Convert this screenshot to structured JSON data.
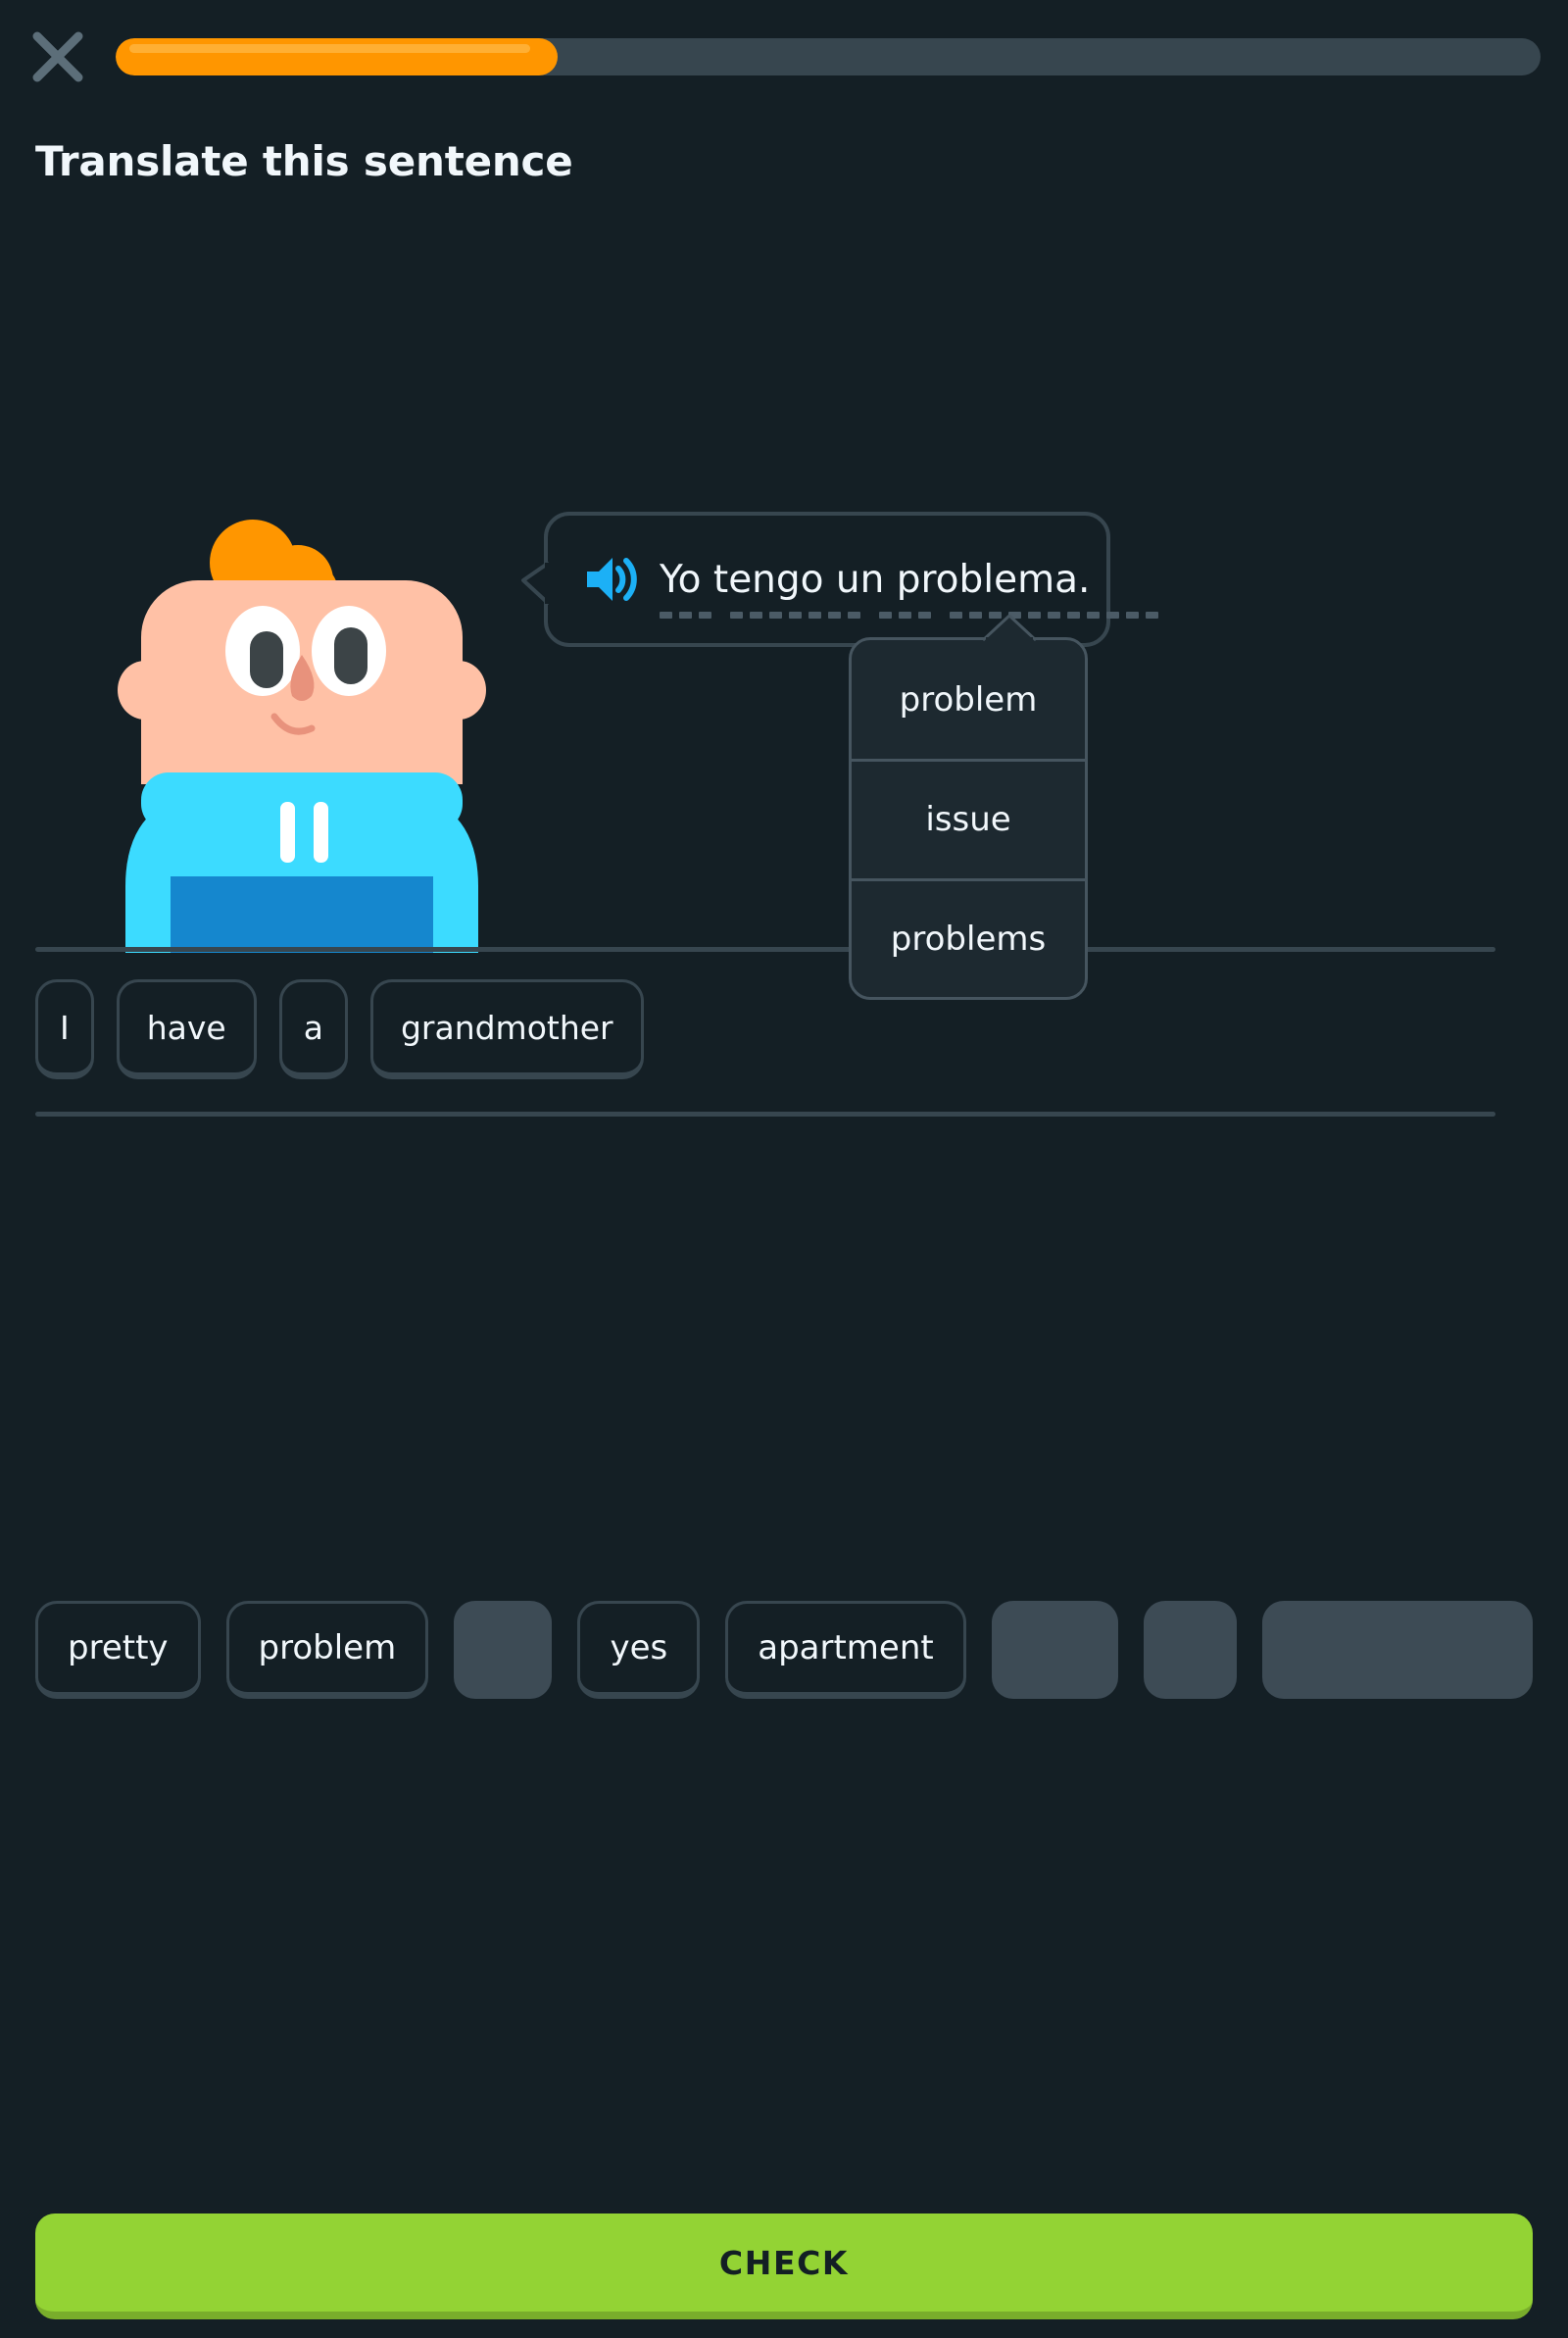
{
  "screen": {
    "name": "translate-exercise",
    "background_color": "#141f25"
  },
  "header": {
    "close_label": "X",
    "close_icon": "close-x-icon",
    "title": "Translate this sentence",
    "progress": {
      "percent": 31,
      "fill_color": "#ff9600",
      "track_color": "#37464f"
    }
  },
  "prompt": {
    "speaker_icon": "speaker-wave-icon",
    "speaker_color": "#1cb0f6",
    "sentence": "Yo tengo un problema.",
    "words": [
      "Yo",
      "tengo",
      "un",
      "problema."
    ],
    "hint_word": "problema"
  },
  "hint_popup": {
    "visible": true,
    "items": [
      {
        "label": "problem"
      },
      {
        "label": "issue"
      },
      {
        "label": "problems"
      }
    ]
  },
  "answer": {
    "tiles": [
      {
        "label": "I"
      },
      {
        "label": "have"
      },
      {
        "label": "a"
      },
      {
        "label": "grandmother"
      }
    ]
  },
  "word_bank": {
    "tiles": [
      {
        "label": "pretty",
        "used": false
      },
      {
        "label": "problem",
        "used": false
      },
      {
        "label": "",
        "used": true
      },
      {
        "label": "yes",
        "used": false
      },
      {
        "label": "apartment",
        "used": false
      },
      {
        "label": "",
        "used": true
      },
      {
        "label": "",
        "used": true
      },
      {
        "label": "",
        "used": true
      }
    ]
  },
  "footer": {
    "check_label": "CHECK",
    "check_color": "#93d334"
  }
}
